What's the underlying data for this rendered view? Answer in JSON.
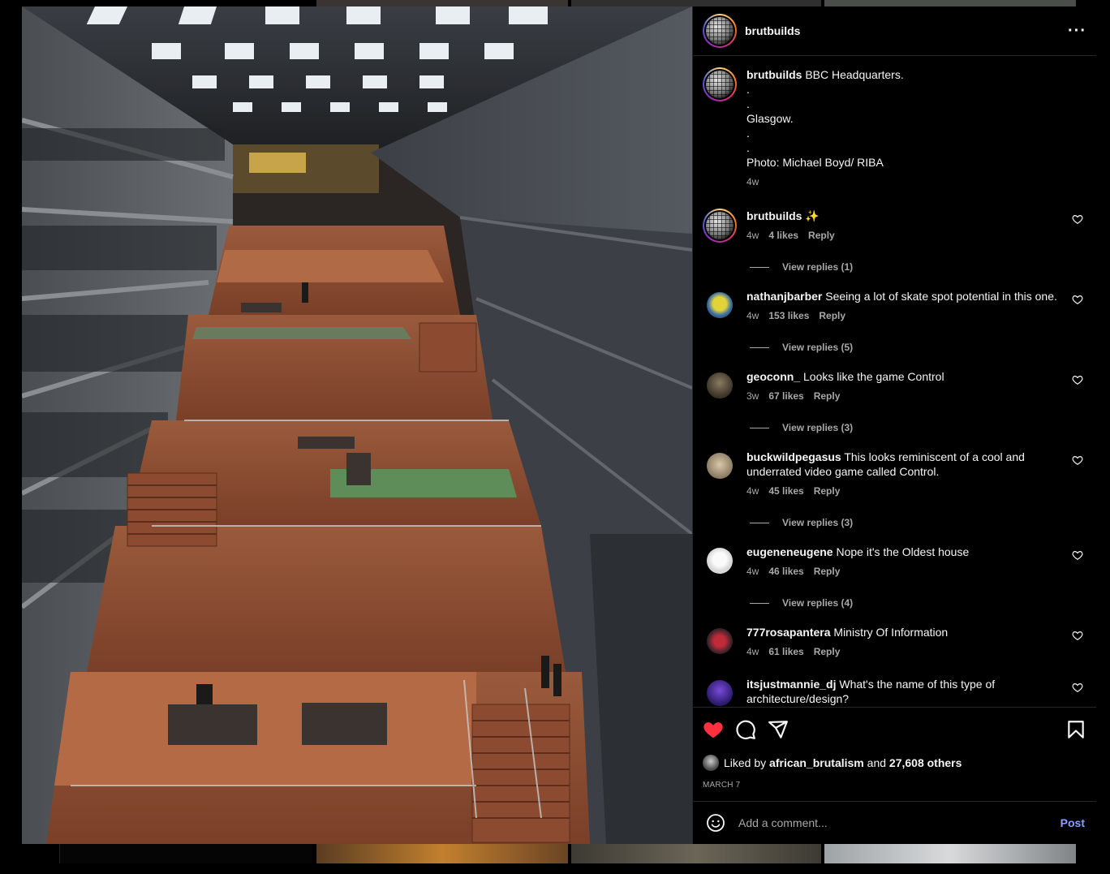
{
  "post": {
    "username": "brutbuilds",
    "more_icon": "more-horizontal-icon",
    "caption": {
      "username": "brutbuilds",
      "lines": [
        "BBC Headquarters.",
        ".",
        ".",
        "Glasgow.",
        ".",
        ".",
        "Photo: Michael Boyd/ RIBA"
      ],
      "time": "4w"
    },
    "photo": {
      "subject": "atrium interior with stepped terraces, stairs and skylights"
    }
  },
  "comments": [
    {
      "username": "brutbuilds",
      "text": "✨",
      "time": "4w",
      "likes": "4 likes",
      "reply": "Reply",
      "view_replies": "View replies (1)"
    },
    {
      "username": "nathanjbarber",
      "text": "Seeing a lot of skate spot potential in this one.",
      "time": "4w",
      "likes": "153 likes",
      "reply": "Reply",
      "view_replies": "View replies (5)"
    },
    {
      "username": "geoconn_",
      "text": "Looks like the game Control",
      "time": "3w",
      "likes": "67 likes",
      "reply": "Reply",
      "view_replies": "View replies (3)"
    },
    {
      "username": "buckwildpegasus",
      "text": "This looks reminiscent of a cool and underrated video game called Control.",
      "time": "4w",
      "likes": "45 likes",
      "reply": "Reply",
      "view_replies": "View replies (3)"
    },
    {
      "username": "eugeneneugene",
      "text": "Nope it's the Oldest house",
      "time": "4w",
      "likes": "46 likes",
      "reply": "Reply",
      "view_replies": "View replies (4)"
    },
    {
      "username": "777rosapantera",
      "text": "Ministry Of Information",
      "time": "4w",
      "likes": "61 likes",
      "reply": "Reply"
    },
    {
      "username": "itsjustmannie_dj",
      "text": "What's the name of this type of architecture/design?"
    }
  ],
  "actions": {
    "like_icon": "heart-filled-icon",
    "comment_icon": "comment-icon",
    "share_icon": "share-icon",
    "save_icon": "bookmark-icon",
    "liked_by_prefix": "Liked by",
    "liked_by_user": "african_brutalism",
    "liked_by_and": "and",
    "liked_by_others": "27,608 others",
    "date": "MARCH 7"
  },
  "add_comment": {
    "emoji_icon": "emoji-icon",
    "placeholder": "Add a comment...",
    "post_label": "Post"
  },
  "colors": {
    "like_red": "#ff3040",
    "post_blue": "#85a1ff",
    "muted": "#a8a8a8"
  }
}
